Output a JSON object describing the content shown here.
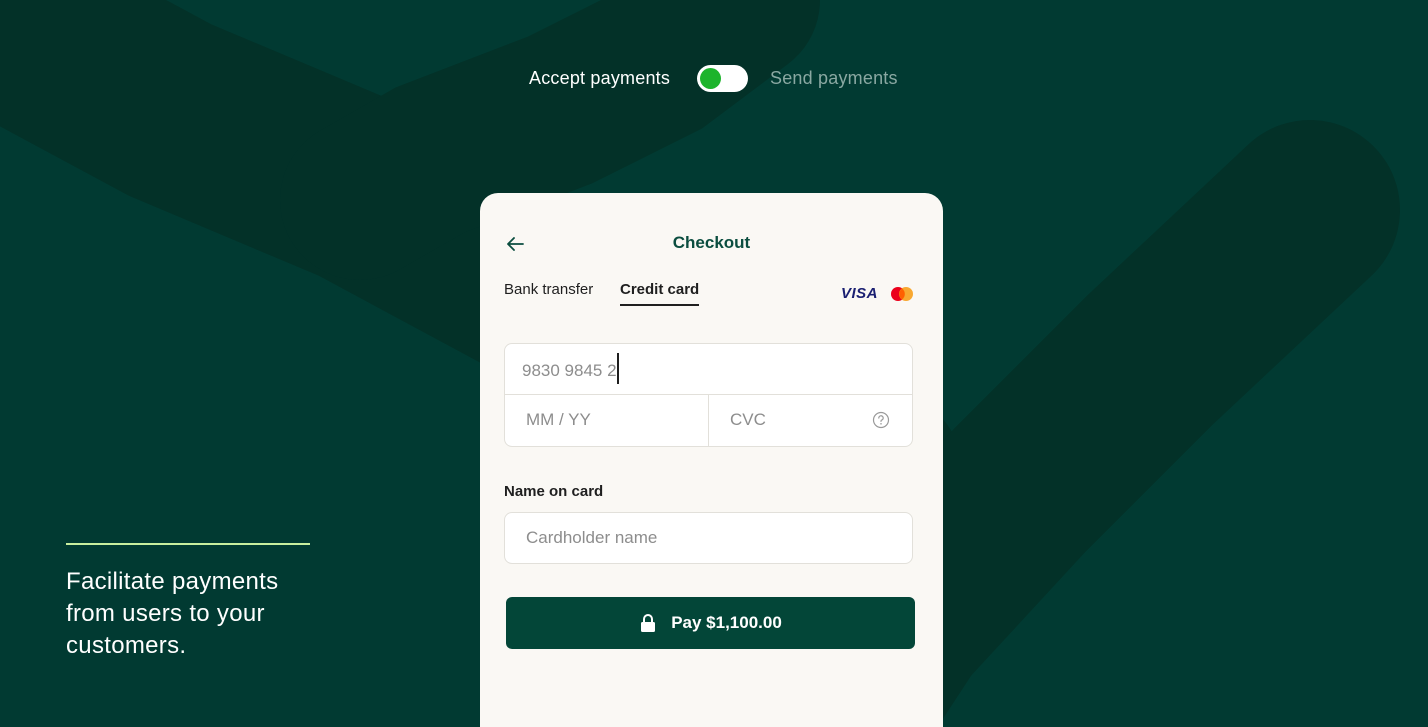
{
  "header": {
    "toggle_left_label": "Accept payments",
    "toggle_right_label": "Send payments",
    "toggle_state": "accept"
  },
  "caption": {
    "text": "Facilitate payments from users to your customers."
  },
  "checkout": {
    "title": "Checkout",
    "tabs": [
      {
        "label": "Bank transfer",
        "active": false
      },
      {
        "label": "Credit card",
        "active": true
      }
    ],
    "card_brands": [
      "VISA",
      "mastercard-logo"
    ],
    "card_number_value": "9830 9845 2",
    "expiry_placeholder": "MM / YY",
    "cvc_placeholder": "CVC",
    "name_label": "Name on card",
    "name_placeholder": "Cardholder name",
    "pay_label": "Pay $1,100.00"
  },
  "colors": {
    "background": "#013a32",
    "accent_green": "#1db42c",
    "button": "#034638",
    "caption_rule": "#c9ef9f"
  }
}
